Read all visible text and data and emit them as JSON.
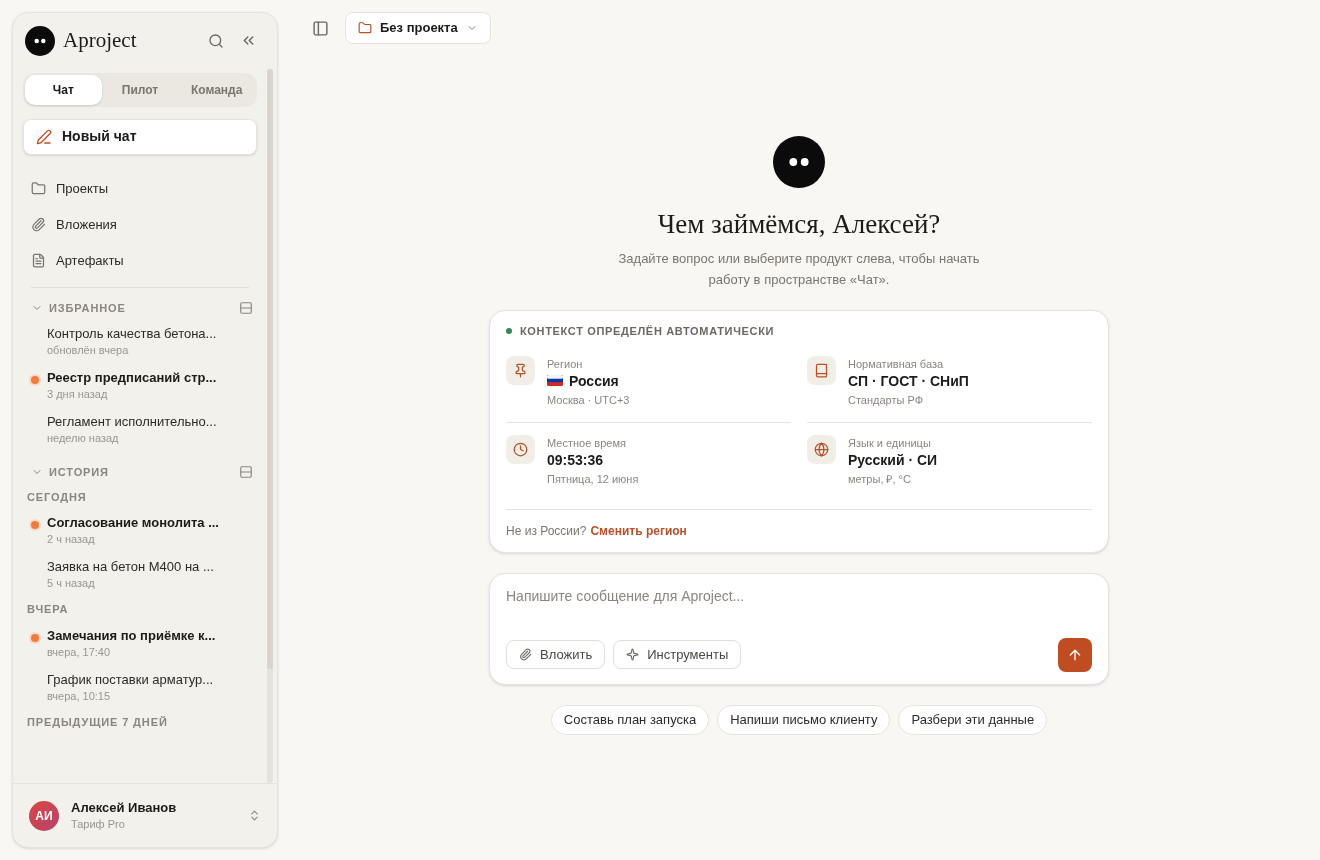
{
  "sidebar": {
    "brand": "Aproject",
    "tabs": [
      {
        "label": "Чат",
        "selected": true
      },
      {
        "label": "Пилот",
        "selected": false
      },
      {
        "label": "Команда",
        "selected": false
      }
    ],
    "new_chat": "Новый чат",
    "nav": [
      {
        "kind": "folder",
        "label": "Проекты"
      },
      {
        "kind": "attachment",
        "label": "Вложения"
      },
      {
        "kind": "document",
        "label": "Артефакты"
      }
    ],
    "favorites": {
      "title": "ИЗБРАННОЕ",
      "expanded": true,
      "items": [
        {
          "title": "Контроль качества бетона...",
          "subtitle": "обновлён вчера",
          "unread": false
        },
        {
          "title": "Реестр предписаний стр...",
          "subtitle": "3 дня назад",
          "unread": true
        },
        {
          "title": "Регламент исполнительно...",
          "subtitle": "неделю назад",
          "unread": false
        }
      ]
    },
    "history": {
      "title": "ИСТОРИЯ",
      "expanded": true,
      "groups": [
        {
          "label": "СЕГОДНЯ",
          "items": [
            {
              "title": "Согласование монолита ...",
              "subtitle": "2 ч назад",
              "unread": true
            },
            {
              "title": "Заявка на бетон М400 на ...",
              "subtitle": "5 ч назад",
              "unread": false
            }
          ]
        },
        {
          "label": "ВЧЕРА",
          "items": [
            {
              "title": "Замечания по приёмке к...",
              "subtitle": "вчера, 17:40",
              "unread": true
            },
            {
              "title": "График поставки арматур...",
              "subtitle": "вчера, 10:15",
              "unread": false
            }
          ]
        },
        {
          "label": "ПРЕДЫДУЩИЕ 7 ДНЕЙ"
        }
      ]
    },
    "user": {
      "initials": "АИ",
      "name": "Алексей Иванов",
      "plan": "Тариф Pro"
    }
  },
  "topbar": {
    "project": "Без проекта"
  },
  "welcome": {
    "heading": "Чем займёмся, Алексей?",
    "subtitle": "Задайте вопрос или выберите продукт слева, чтобы начать работу в пространстве «Чат»."
  },
  "context": {
    "title": "КОНТЕКСТ ОПРЕДЕЛЁН АВТОМАТИЧЕСКИ",
    "items": [
      {
        "kind": "region",
        "label": "Регион",
        "value": "Россия",
        "note": "Москва · UTC+3"
      },
      {
        "kind": "norms",
        "label": "Нормативная база",
        "value": "СП · ГОСТ · СНиП",
        "note": "Стандарты РФ"
      },
      {
        "kind": "time",
        "label": "Местное время",
        "value": "09:53:36",
        "note": "Пятница, 12 июня"
      },
      {
        "kind": "language",
        "label": "Язык и единицы",
        "value": "Русский · СИ",
        "note": "метры, ₽, °C"
      }
    ],
    "footer": "Не из России?",
    "link": "Сменить регион"
  },
  "composer": {
    "placeholder": "Напишите сообщение для Aproject...",
    "buttons": [
      {
        "kind": "attach",
        "label": "Вложить"
      },
      {
        "kind": "tools",
        "label": "Инструменты"
      }
    ]
  },
  "suggestions": [
    "Составь план запуска",
    "Напиши письмо клиенту",
    "Разбери эти данные"
  ]
}
